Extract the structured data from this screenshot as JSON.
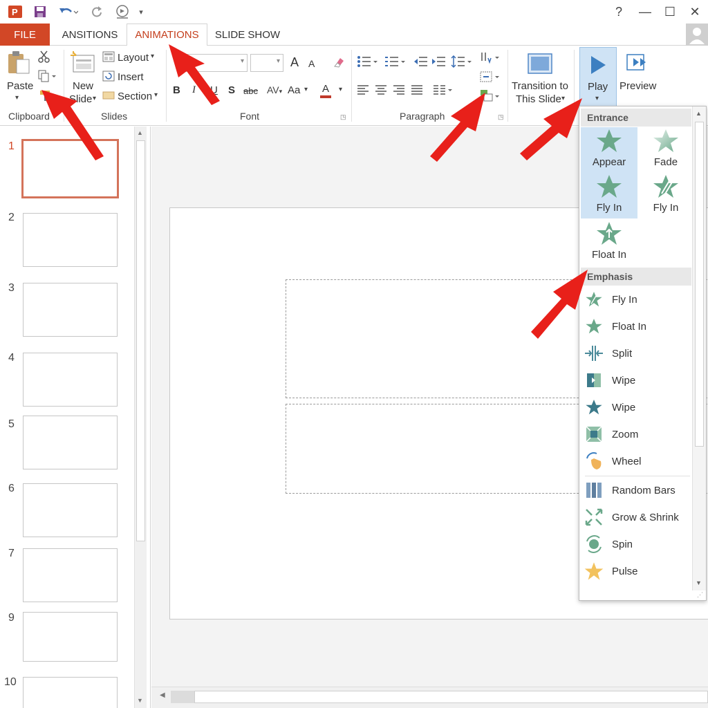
{
  "title_bar": {
    "icons": [
      "powerpoint-logo-icon",
      "save-icon",
      "undo-icon",
      "redo-icon",
      "present-icon",
      "customize-icon"
    ],
    "help": "?",
    "minimize": "—",
    "maximize": "☐",
    "close": "✕"
  },
  "tabs": {
    "file": "FILE",
    "transitions": "ANSITIONS",
    "animations": "ANIMATIONS",
    "slideshow": "SLIDE SHOW"
  },
  "ribbon": {
    "clipboard": {
      "paste": "Paste",
      "label": "Clipboard"
    },
    "slides": {
      "new_slide_1": "New",
      "new_slide_2": "Slide",
      "layout": "Layout",
      "insert": "Insert",
      "section": "Section",
      "label": "Slides"
    },
    "font": {
      "label": "Font",
      "bold": "B",
      "italic": "I",
      "underline": "U",
      "shadow": "S",
      "strike": "abc",
      "case": "Aa",
      "color": "A",
      "grow": "A",
      "shrink": "A"
    },
    "paragraph": {
      "label": "Paragraph"
    },
    "transition": {
      "line1": "Transition to",
      "line2": "This Slide"
    },
    "play": {
      "label": "Play"
    },
    "preview": {
      "label": "Preview"
    }
  },
  "thumbnails": [
    "1",
    "2",
    "3",
    "4",
    "5",
    "6",
    "7",
    "9",
    "10"
  ],
  "gallery": {
    "entrance_header": "Entrance",
    "entrance": [
      {
        "label": "Appear",
        "icon": "appear-star-icon",
        "selected": true
      },
      {
        "label": "Fade",
        "icon": "fade-star-icon",
        "selected": false
      },
      {
        "label": "Fly In",
        "icon": "fly-in-star-icon",
        "selected": true
      },
      {
        "label": "Fly In",
        "icon": "fly-in-star-outline-icon",
        "selected": false
      },
      {
        "label": "Float In",
        "icon": "float-in-star-icon",
        "selected": false
      }
    ],
    "emphasis_header": "Emphasis",
    "emphasis": [
      {
        "label": "Fly In",
        "icon": "fly-in-icon"
      },
      {
        "label": "Float In",
        "icon": "float-in-icon"
      },
      {
        "label": "Split",
        "icon": "split-icon"
      },
      {
        "label": "Wipe",
        "icon": "wipe-icon"
      },
      {
        "label": "Wipe",
        "icon": "wipe-star-icon"
      },
      {
        "label": "Zoom",
        "icon": "zoom-icon"
      },
      {
        "label": "Wheel",
        "icon": "wheel-icon"
      },
      {
        "label": "Random Bars",
        "icon": "random-bars-icon"
      },
      {
        "label": "Grow & Shrink",
        "icon": "grow-shrink-icon"
      },
      {
        "label": "Spin",
        "icon": "spin-icon"
      },
      {
        "label": "Pulse",
        "icon": "pulse-icon"
      }
    ]
  },
  "colors": {
    "accent": "#d24726",
    "active_tab_text": "#c43e1c",
    "selected_tile": "#cfe3f5",
    "star_green": "#6aa88a",
    "play_blue": "#3c7fc1",
    "annotation_arrow": "#e8201a"
  }
}
